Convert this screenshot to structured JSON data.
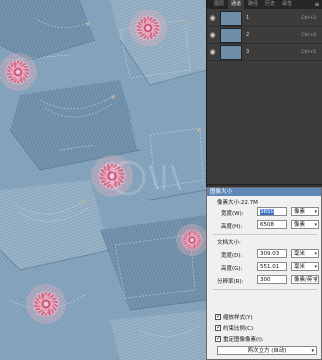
{
  "channels_panel": {
    "tabs": [
      "图层",
      "通道",
      "路径",
      "历史",
      "属性"
    ],
    "active_tab": 1,
    "rows": [
      {
        "name": "1",
        "shortcut": "Ctrl+3",
        "selected": true
      },
      {
        "name": "2",
        "shortcut": "Ctrl+4",
        "selected": false
      },
      {
        "name": "3",
        "shortcut": "Ctrl+5",
        "selected": false
      }
    ]
  },
  "dialog": {
    "title": "图像大小",
    "pixel_size": "像素大小:22.7M",
    "pixel_section": {
      "width_label": "宽度(W):",
      "width_value": "3650",
      "width_unit": "像素",
      "height_label": "高度(H):",
      "height_value": "6508",
      "height_unit": "像素"
    },
    "doc_section": {
      "title": "文档大小:",
      "width_label": "宽度(D):",
      "width_value": "309.03",
      "width_unit": "毫米",
      "height_label": "高度(G):",
      "height_value": "551.01",
      "height_unit": "毫米",
      "res_label": "分辨率(R):",
      "res_value": "300",
      "res_unit": "像素/英寸"
    },
    "options": [
      {
        "label": "缩放样式(Y)",
        "checked": true
      },
      {
        "label": "约束比例(C)",
        "checked": true
      },
      {
        "label": "重定图像像素(I):",
        "checked": true
      }
    ],
    "resample_method": "两次立方 (自动)"
  },
  "colors": {
    "denim": "#7f9fb8",
    "flower": "#d98aa6",
    "panel_bg": "#3c3c3c",
    "dialog_title": "#5e86b7"
  }
}
